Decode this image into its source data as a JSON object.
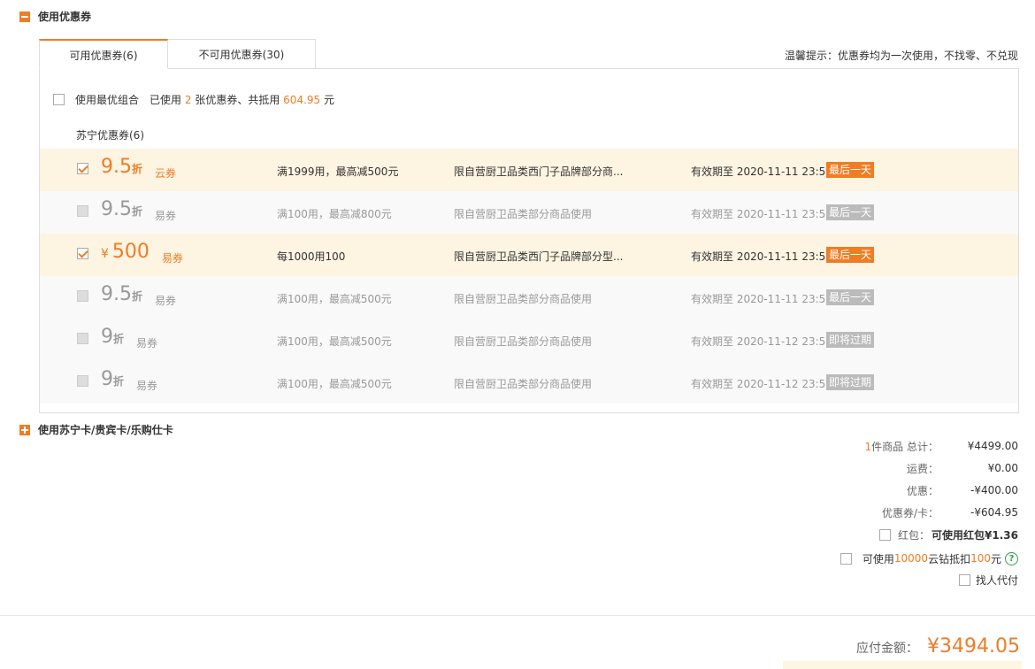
{
  "coupon_section": {
    "title": "使用优惠券"
  },
  "tabs": {
    "available": "可用优惠券(6)",
    "unavailable": "不可用优惠券(30)"
  },
  "tip": "温馨提示：优惠券均为一次使用，不找零、不兑现",
  "best_combo": {
    "label": "使用最优组合",
    "used_prefix": "已使用",
    "used_count": "2",
    "used_mid": "张优惠券、共抵用",
    "used_amount": "604.95",
    "used_suffix": "元"
  },
  "group_title": "苏宁优惠券(6)",
  "coupons": [
    {
      "checked": true,
      "currency": "",
      "value": "9.5",
      "unit": "折",
      "type": "云券",
      "rule": "满1999用，最高减500元",
      "limit": "限自营厨卫品类西门子品牌部分商...",
      "valid": "有效期至  2020-11-11 23:59",
      "badge": "最后一天"
    },
    {
      "checked": false,
      "currency": "",
      "value": "9.5",
      "unit": "折",
      "type": "易券",
      "rule": "满100用，最高减800元",
      "limit": "限自营厨卫品类部分商品使用",
      "valid": "有效期至  2020-11-11 23:59",
      "badge": "最后一天"
    },
    {
      "checked": true,
      "currency": "¥",
      "value": "500",
      "unit": "",
      "type": "易券",
      "rule": "每1000用100",
      "limit": "限自营厨卫品类西门子品牌部分型...",
      "valid": "有效期至  2020-11-11 23:59",
      "badge": "最后一天"
    },
    {
      "checked": false,
      "currency": "",
      "value": "9.5",
      "unit": "折",
      "type": "易券",
      "rule": "满100用，最高减500元",
      "limit": "限自营厨卫品类部分商品使用",
      "valid": "有效期至  2020-11-11 23:59",
      "badge": "最后一天"
    },
    {
      "checked": false,
      "currency": "",
      "value": "9",
      "unit": "折",
      "type": "易券",
      "rule": "满100用，最高减500元",
      "limit": "限自营厨卫品类部分商品使用",
      "valid": "有效期至  2020-11-12 23:59",
      "badge": "即将过期"
    },
    {
      "checked": false,
      "currency": "",
      "value": "9",
      "unit": "折",
      "type": "易券",
      "rule": "满100用，最高减500元",
      "limit": "限自营厨卫品类部分商品使用",
      "valid": "有效期至  2020-11-12 23:59",
      "badge": "即将过期"
    }
  ],
  "card_section": {
    "title": "使用苏宁卡/贵宾卡/乐购仕卡"
  },
  "summary": {
    "count": "1",
    "total_label": "件商品 总计：",
    "total": "¥4499.00",
    "shipping_label": "运费：",
    "shipping": "¥0.00",
    "discount_label": "优惠：",
    "discount": "-¥400.00",
    "coupon_label": "优惠券/卡：",
    "coupon": "-¥604.95",
    "redpacket_label": "红包：",
    "redpacket": "可使用红包¥1.36",
    "yunzuan_prefix": "可使用",
    "yunzuan_amount": "10000",
    "yunzuan_mid": "云钻抵扣",
    "yunzuan_value": "100",
    "yunzuan_suffix": "元",
    "proxy_pay": "找人代付",
    "payable_label": "应付金额：",
    "payable": "¥3494.05"
  },
  "colors": {
    "accent": "#f07c24",
    "selected_row": "#fdf4e2",
    "help": "#2ba245"
  },
  "icons": {
    "collapse": "minus-square-icon",
    "expand": "plus-square-icon",
    "help": "question-circle-icon",
    "check": "checkmark-icon"
  }
}
